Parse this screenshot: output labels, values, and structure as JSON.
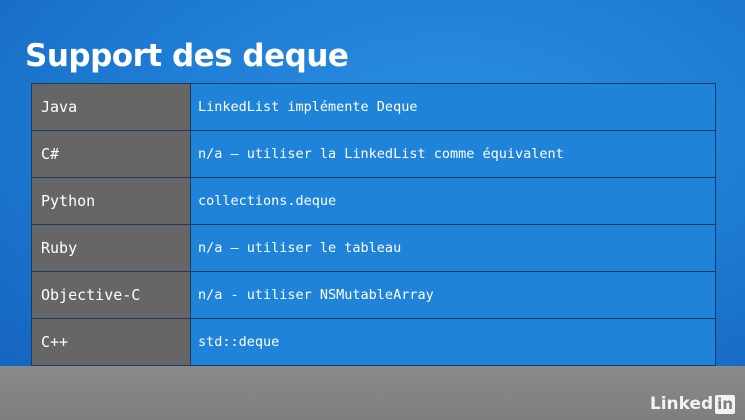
{
  "title": "Support des deque",
  "rows": [
    {
      "language": "Java",
      "support": "LinkedList implémente Deque"
    },
    {
      "language": "C#",
      "support": "n/a – utiliser la LinkedList comme équivalent"
    },
    {
      "language": "Python",
      "support": "collections.deque"
    },
    {
      "language": "Ruby",
      "support": "n/a – utiliser le tableau"
    },
    {
      "language": "Objective-C",
      "support": "n/a - utiliser NSMutableArray"
    },
    {
      "language": "C++",
      "support": "std::deque"
    }
  ],
  "watermark": {
    "brand_prefix": "Linked",
    "brand_suffix": "in"
  },
  "colors": {
    "slide_background": "#1f7ed6",
    "language_cell": "#666666",
    "description_cell": "#1f83d9",
    "footer_bar": "#7e7e7e",
    "text": "#ffffff"
  }
}
